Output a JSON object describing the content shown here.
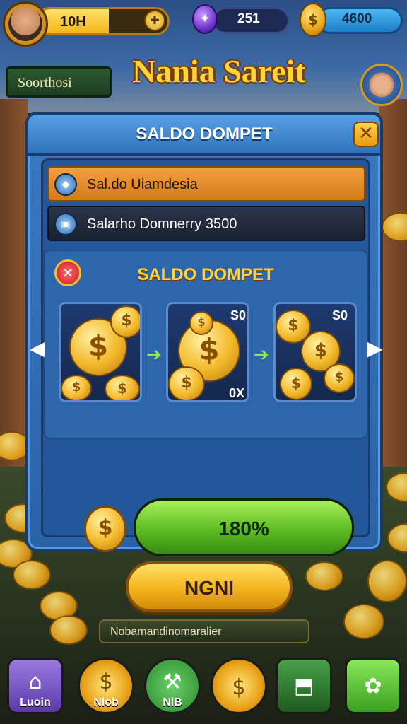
{
  "hud": {
    "level_value": "10H",
    "level_fill_fraction": 0.55,
    "gem_amount": "251",
    "coin_amount": "4600"
  },
  "header": {
    "search_text": "Soorthosi",
    "title": "Nania Sareit"
  },
  "modal": {
    "title": "SALDO DOMPET",
    "close_glyph": "✕",
    "rows": [
      {
        "label": "Sal.do Uiamdesia"
      },
      {
        "label": "Salarho Domnerry 3500"
      }
    ],
    "panel": {
      "title": "SALDO DOMPET",
      "close_glyph": "✕",
      "cards": [
        {
          "label": ""
        },
        {
          "label": "S0",
          "sublabel": "0X"
        },
        {
          "label": "S0"
        }
      ],
      "arrow_glyph": "➔"
    },
    "progress": {
      "value_text": "180%",
      "fill_fraction": 1.0
    }
  },
  "action_button": {
    "label": "NGNI"
  },
  "notice": {
    "text": "Nobamandinomaralier"
  },
  "nav": {
    "items": [
      {
        "label": "Luoin",
        "icon": "house-icon",
        "color": "#7a5ac8"
      },
      {
        "label": "Nlob",
        "icon": "dollar-icon",
        "color": "#e8a318"
      },
      {
        "label": "NlB",
        "icon": "tool-icon",
        "color": "#3a9a3a"
      },
      {
        "label": "",
        "icon": "dollar-icon",
        "color": "#e8a318"
      },
      {
        "label": "",
        "icon": "map-icon",
        "color": "#2e7a2e"
      },
      {
        "label": "",
        "icon": "clover-icon",
        "color": "#5cc83a"
      }
    ]
  },
  "colors": {
    "accent_gold": "#ffd33a",
    "modal_blue": "#3a7ac4",
    "progress_green": "#5cbc22"
  }
}
